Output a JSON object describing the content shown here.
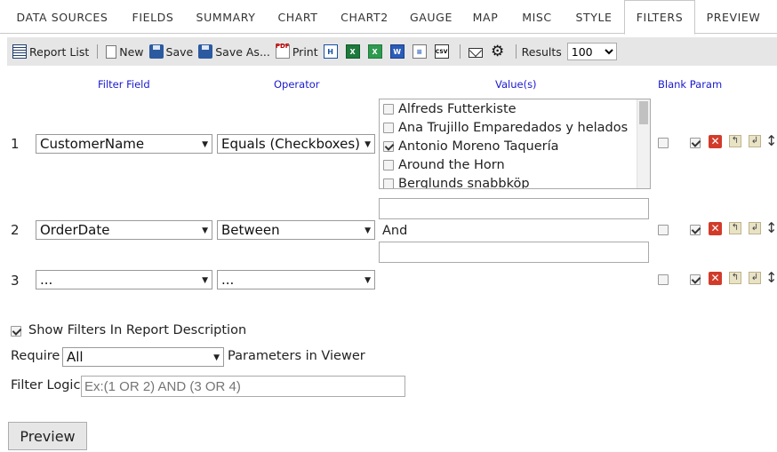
{
  "tabs": [
    {
      "label": "DATA SOURCES",
      "active": false
    },
    {
      "label": "FIELDS",
      "active": false
    },
    {
      "label": "SUMMARY",
      "active": false
    },
    {
      "label": "CHART",
      "active": false
    },
    {
      "label": "CHART2",
      "active": false
    },
    {
      "label": "GAUGE",
      "active": false
    },
    {
      "label": "MAP",
      "active": false
    },
    {
      "label": "MISC",
      "active": false
    },
    {
      "label": "STYLE",
      "active": false
    },
    {
      "label": "FILTERS",
      "active": true
    },
    {
      "label": "PREVIEW",
      "active": false
    }
  ],
  "toolbar": {
    "report_list": "Report List",
    "new": "New",
    "save": "Save",
    "save_as": "Save As...",
    "print": "Print",
    "results_label": "Results",
    "results_value": "100",
    "icons": [
      "list-icon",
      "new-document-icon",
      "floppy-disk-icon",
      "floppy-disk-icon",
      "pdf-icon",
      "html-export-icon",
      "excel-export-icon",
      "excel-icon",
      "word-icon",
      "document-icon",
      "csv-icon",
      "mail-icon",
      "gear-icon"
    ]
  },
  "columns": {
    "filter_field": "Filter Field",
    "operator": "Operator",
    "values": "Value(s)",
    "blank_param": "Blank Param"
  },
  "filters": [
    {
      "num": "1",
      "field": "CustomerName",
      "operator": "Equals (Checkboxes)",
      "options": [
        {
          "label": "Alfreds Futterkiste",
          "checked": false
        },
        {
          "label": "Ana Trujillo Emparedados y helados",
          "checked": false
        },
        {
          "label": "Antonio Moreno Taquería",
          "checked": true
        },
        {
          "label": "Around the Horn",
          "checked": false
        },
        {
          "label": "Berglunds snabbköp",
          "checked": false
        }
      ],
      "blank_param": false,
      "enabled": true
    },
    {
      "num": "2",
      "field": "OrderDate",
      "operator": "Between",
      "value_from": "",
      "between_label": "And",
      "value_to": "",
      "blank_param": false,
      "enabled": true
    },
    {
      "num": "3",
      "field": "...",
      "operator": "...",
      "blank_param": false,
      "enabled": true
    }
  ],
  "options": {
    "show_filters_label": "Show Filters In Report Description",
    "show_filters_checked": true,
    "require_label": "Require",
    "require_value": "All",
    "params_label": "Parameters in Viewer",
    "filter_logic_label": "Filter Logic",
    "filter_logic_value": "Ex:(1 OR 2) AND (3 OR 4)"
  },
  "preview_button": "Preview",
  "colors": {
    "header_text": "#1a1ad0",
    "toolbar_bg": "#e6e6e6",
    "delete_red": "#d23b2a"
  }
}
